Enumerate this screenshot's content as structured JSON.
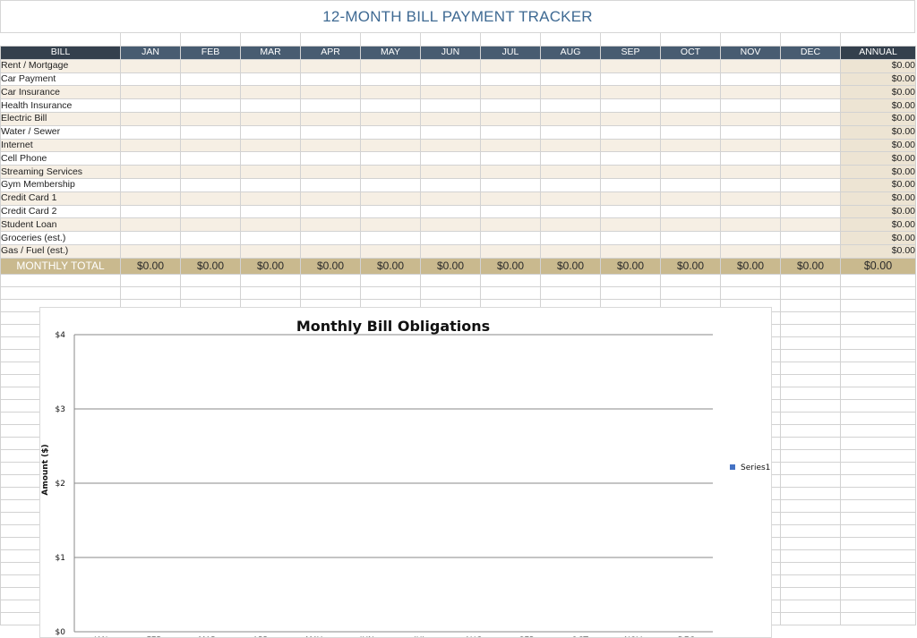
{
  "sheet": {
    "title": "12-MONTH BILL PAYMENT TRACKER",
    "header": {
      "bill": "BILL",
      "months": [
        "JAN",
        "FEB",
        "MAR",
        "APR",
        "MAY",
        "JUN",
        "JUL",
        "AUG",
        "SEP",
        "OCT",
        "NOV",
        "DEC"
      ],
      "annual": "ANNUAL"
    },
    "rows": [
      {
        "label": "Rent / Mortgage",
        "annual": "$0.00"
      },
      {
        "label": "Car Payment",
        "annual": "$0.00"
      },
      {
        "label": "Car Insurance",
        "annual": "$0.00"
      },
      {
        "label": "Health Insurance",
        "annual": "$0.00"
      },
      {
        "label": "Electric Bill",
        "annual": "$0.00"
      },
      {
        "label": "Water / Sewer",
        "annual": "$0.00"
      },
      {
        "label": "Internet",
        "annual": "$0.00"
      },
      {
        "label": "Cell Phone",
        "annual": "$0.00"
      },
      {
        "label": "Streaming Services",
        "annual": "$0.00"
      },
      {
        "label": "Gym Membership",
        "annual": "$0.00"
      },
      {
        "label": "Credit Card 1",
        "annual": "$0.00"
      },
      {
        "label": "Credit Card 2",
        "annual": "$0.00"
      },
      {
        "label": "Student Loan",
        "annual": "$0.00"
      },
      {
        "label": "Groceries (est.)",
        "annual": "$0.00"
      },
      {
        "label": "Gas / Fuel (est.)",
        "annual": "$0.00"
      }
    ],
    "total": {
      "label": "MONTHLY TOTAL",
      "values": [
        "$0.00",
        "$0.00",
        "$0.00",
        "$0.00",
        "$0.00",
        "$0.00",
        "$0.00",
        "$0.00",
        "$0.00",
        "$0.00",
        "$0.00",
        "$0.00"
      ],
      "annual": "$0.00"
    },
    "colors": {
      "header": "#485c71",
      "header_dark": "#34404d",
      "title": "#3f6a93",
      "row_tint": "#f6efe4",
      "total": "#c9b98e",
      "series": "#4472c4"
    }
  },
  "chart_data": {
    "type": "bar",
    "title": "Monthly Bill Obligations",
    "ylabel": "Amount ($)",
    "xlabel": "",
    "categories": [
      "JAN",
      "FEB",
      "MAR",
      "APR",
      "MAY",
      "JUN",
      "JUL",
      "AUG",
      "SEP",
      "OCT",
      "NOV",
      "DEC"
    ],
    "series": [
      {
        "name": "Series1",
        "values": [
          0,
          0,
          0,
          0,
          0,
          0,
          0,
          0,
          0,
          0,
          0,
          0
        ]
      }
    ],
    "ylim": [
      0,
      4
    ],
    "yticks": [
      "$0",
      "$1",
      "$2",
      "$3",
      "$4"
    ],
    "grid": true,
    "legend": "right"
  }
}
